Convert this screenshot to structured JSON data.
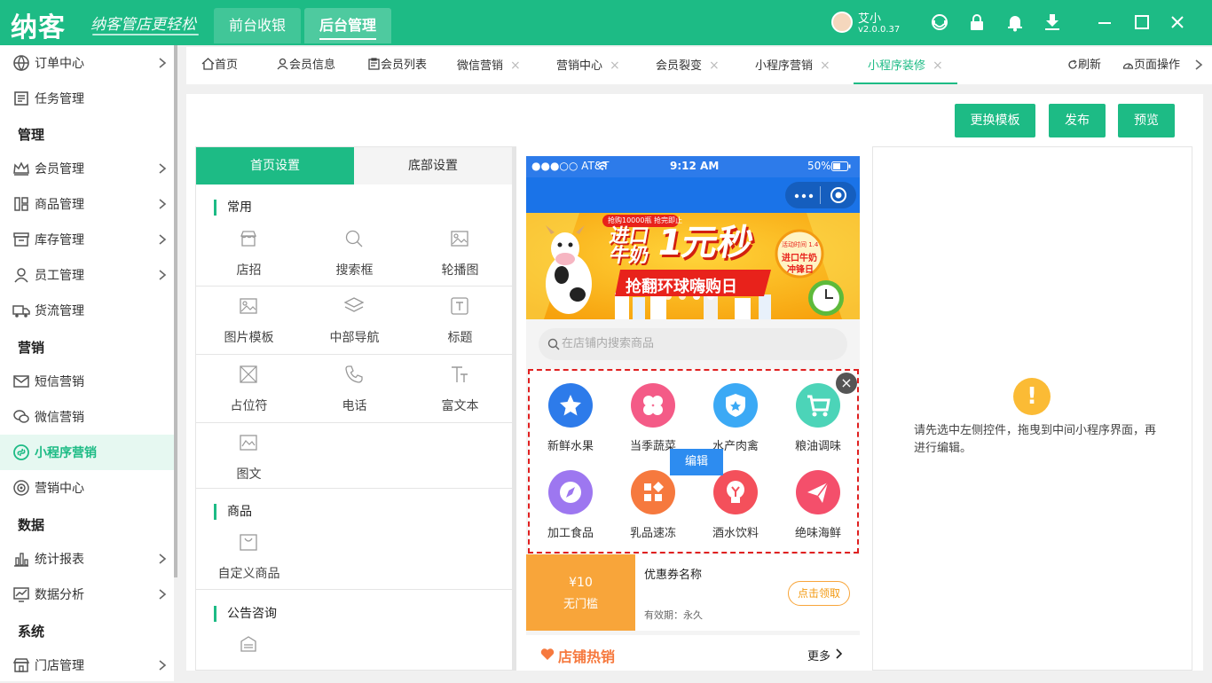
{
  "app": {
    "logo": "纳客",
    "slogan": "纳客管店更轻松"
  },
  "top_tabs": [
    {
      "label": "前台收银"
    },
    {
      "label": "后台管理"
    }
  ],
  "user": {
    "name": "艾小",
    "version": "v2.0.0.37"
  },
  "sidebar": {
    "items": [
      {
        "label": "订单中心"
      },
      {
        "label": "任务管理"
      },
      {
        "label": "会员管理"
      },
      {
        "label": "商品管理"
      },
      {
        "label": "库存管理"
      },
      {
        "label": "员工管理"
      },
      {
        "label": "货流管理"
      },
      {
        "label": "短信营销"
      },
      {
        "label": "微信营销"
      },
      {
        "label": "小程序营销"
      },
      {
        "label": "营销中心"
      },
      {
        "label": "统计报表"
      },
      {
        "label": "数据分析"
      },
      {
        "label": "门店管理"
      }
    ],
    "headers": [
      "管理",
      "营销",
      "数据",
      "系统"
    ]
  },
  "tabs": [
    {
      "label": "首页"
    },
    {
      "label": "会员信息"
    },
    {
      "label": "会员列表"
    },
    {
      "label": "微信营销"
    },
    {
      "label": "营销中心"
    },
    {
      "label": "会员裂变"
    },
    {
      "label": "小程序营销"
    },
    {
      "label": "小程序装修"
    }
  ],
  "tab_close": "×",
  "tab_actions": {
    "refresh": "刷新",
    "page_ops": "页面操作"
  },
  "buttons": {
    "change_template": "更换模板",
    "publish": "发布",
    "preview": "预览"
  },
  "left_panel": {
    "tabs": [
      "首页设置",
      "底部设置"
    ],
    "sections": [
      {
        "title": "常用",
        "widgets": [
          "店招",
          "搜索框",
          "轮播图",
          "图片模板",
          "中部导航",
          "标题",
          "占位符",
          "电话",
          "富文本",
          "图文"
        ]
      },
      {
        "title": "商品",
        "widgets": [
          "自定义商品"
        ]
      },
      {
        "title": "公告咨询",
        "widgets": []
      }
    ]
  },
  "phone": {
    "carrier": "●●●○○ AT&T",
    "time": "9:12 AM",
    "battery": "50%",
    "banner": {
      "badge": "抢购10000瓶 抢完即止",
      "headline1": "进口",
      "headline2": "牛奶",
      "headline3": "1元秒",
      "sub": "抢翻环球嗨购日",
      "tag1": "活动时间 1.4",
      "tag2": "进口牛奶",
      "tag3": "冲锋日"
    },
    "search_placeholder": "在店铺内搜索商品",
    "nav_items": [
      {
        "label": "新鲜水果",
        "color": "#2d7bea"
      },
      {
        "label": "当季蔬菜",
        "color": "#f45b87"
      },
      {
        "label": "水产肉禽",
        "color": "#3ba9f5"
      },
      {
        "label": "粮油调味",
        "color": "#4cd4b8"
      },
      {
        "label": "加工食品",
        "color": "#9d77f0"
      },
      {
        "label": "乳品速冻",
        "color": "#f6793e"
      },
      {
        "label": "酒水饮料",
        "color": "#f4505b"
      },
      {
        "label": "绝味海鲜",
        "color": "#f44f6b"
      }
    ],
    "edit_label": "编辑",
    "close_glyph": "×",
    "coupon": {
      "amount": "¥10",
      "condition": "无门槛",
      "name": "优惠券名称",
      "validity": "有效期：永久",
      "claim": "点击领取"
    },
    "hot": {
      "title": "店铺热销",
      "more": "更多"
    }
  },
  "right_panel": {
    "warn_glyph": "!",
    "hint": "请先选中左侧控件，拖曳到中间小程序界面，再进行编辑。"
  },
  "colors": {
    "primary": "#1dbb85",
    "phone_blue": "#1a73e8",
    "warning": "#fbbb35",
    "coupon": "#f8a53a"
  }
}
